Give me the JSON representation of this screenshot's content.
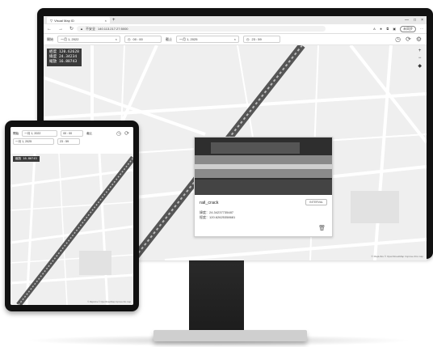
{
  "browser": {
    "tab_title": "Visual Map ID",
    "tab_close": "×",
    "new_tab": "+",
    "window_controls": [
      "—",
      "□",
      "×"
    ],
    "security_label": "不安全",
    "url": "140.113.217.27:5000",
    "profile_label": "未同步"
  },
  "toolbar": {
    "start_label": "開始",
    "start_date": "一月 1, 2022",
    "start_time": "00 : 00",
    "end_label": "截止",
    "end_date": "一月 1, 2025",
    "end_time": "23 : 59",
    "icons": [
      "clock-icon",
      "refresh-icon",
      "settings-icon"
    ]
  },
  "map": {
    "coords": {
      "lon": "經度 120.62628",
      "lat": "緯度 24.34234",
      "zoom": "縮放 16.88743"
    },
    "zoom_in": "+",
    "zoom_out": "−",
    "attribution": "© MapLibre © OpenStreetMap Improve this map"
  },
  "popup": {
    "title": "rail_crack",
    "button": "INTERVAL",
    "lat": "緯度：24.34237735487",
    "lon": "經度：120.62625358681"
  },
  "tablet": {
    "start_label": "開始",
    "start_date": "一月 1, 2022",
    "start_time": "00 : 00",
    "end_label": "截止",
    "end_date": "一月 1, 2025",
    "end_time": "23 : 59",
    "coords": "縮放 16.80743",
    "attribution": "© MapLibre © OpenStreetMap Improve this map"
  },
  "colors": {
    "frame": "#111111",
    "map_bg": "#efefef",
    "rail": "#555555",
    "road": "#ffffff"
  }
}
